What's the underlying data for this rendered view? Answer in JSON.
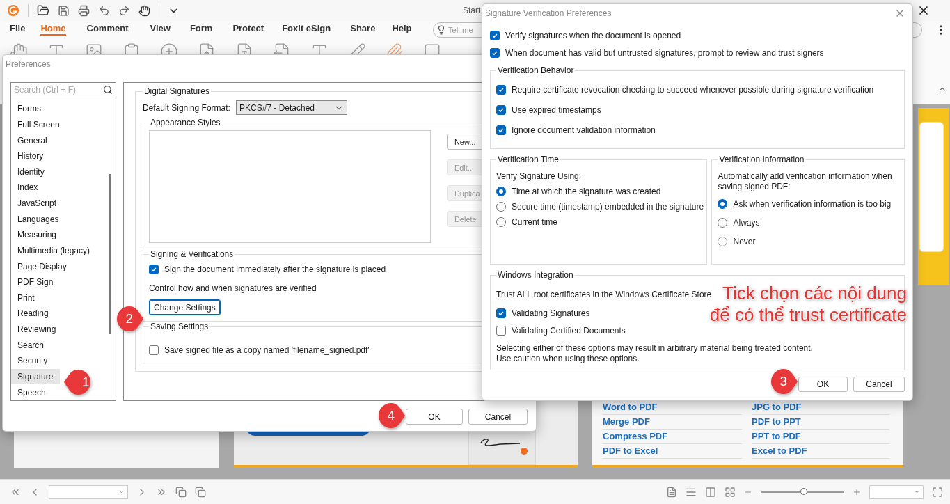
{
  "app": {
    "title": "Start",
    "menu": [
      {
        "label": "File",
        "selected": false
      },
      {
        "label": "Home",
        "selected": true
      },
      {
        "label": "Comment",
        "selected": false
      },
      {
        "label": "View",
        "selected": false
      },
      {
        "label": "Form",
        "selected": false
      },
      {
        "label": "Protect",
        "selected": false
      },
      {
        "label": "Foxit eSign",
        "selected": false
      },
      {
        "label": "Share",
        "selected": false
      },
      {
        "label": "Help",
        "selected": false
      }
    ],
    "search_placeholder": "Tell me",
    "quick_links": [
      {
        "label": "Word to PDF"
      },
      {
        "label": "JPG to PDF"
      },
      {
        "label": "Merge PDF"
      },
      {
        "label": "PDF to PPT"
      },
      {
        "label": "Compress PDF"
      },
      {
        "label": "PPT to PDF"
      },
      {
        "label": "PDF to Excel"
      },
      {
        "label": "Excel to PDF"
      }
    ],
    "zoom_slider": {
      "level": 0.52
    }
  },
  "preferences": {
    "title": "Preferences",
    "search_placeholder": "Search (Ctrl + F)",
    "categories": [
      {
        "label": "Forms",
        "selected": false
      },
      {
        "label": "Full Screen",
        "selected": false
      },
      {
        "label": "General",
        "selected": false
      },
      {
        "label": "History",
        "selected": false
      },
      {
        "label": "Identity",
        "selected": false
      },
      {
        "label": "Index",
        "selected": false
      },
      {
        "label": "JavaScript",
        "selected": false
      },
      {
        "label": "Languages",
        "selected": false
      },
      {
        "label": "Measuring",
        "selected": false
      },
      {
        "label": "Multimedia (legacy)",
        "selected": false
      },
      {
        "label": "Page Display",
        "selected": false
      },
      {
        "label": "PDF Sign",
        "selected": false
      },
      {
        "label": "Print",
        "selected": false
      },
      {
        "label": "Reading",
        "selected": false
      },
      {
        "label": "Reviewing",
        "selected": false
      },
      {
        "label": "Search",
        "selected": false
      },
      {
        "label": "Security",
        "selected": false
      },
      {
        "label": "Signature",
        "selected": true
      },
      {
        "label": "Speech",
        "selected": false
      }
    ],
    "digital_signatures": {
      "title": "Digital Signatures",
      "format_label": "Default Signing Format:",
      "format_value": "PKCS#7 - Detached"
    },
    "appearance_styles": {
      "title": "Appearance Styles",
      "buttons": [
        {
          "label": "New...",
          "disabled": false
        },
        {
          "label": "Edit...",
          "disabled": true
        },
        {
          "label": "Duplica",
          "disabled": true
        },
        {
          "label": "Delete",
          "disabled": true
        }
      ]
    },
    "signing": {
      "title": "Signing & Verifications",
      "option": {
        "label": "Sign the document immediately after the signature is placed",
        "checked": true
      },
      "description": "Control how and when signatures are verified",
      "button": "Change Settings"
    },
    "saving": {
      "title": "Saving Settings",
      "option": {
        "label": "Save signed file as a copy named 'filename_signed.pdf'",
        "checked": false
      }
    },
    "buttons": [
      "OK",
      "Cancel"
    ]
  },
  "verification": {
    "title": "Signature Verification Preferences",
    "options": [
      {
        "label": "Verify signatures when the document is opened",
        "checked": true
      },
      {
        "label": "When document has valid but untrusted signatures, prompt to review and trust signers",
        "checked": true
      }
    ],
    "behavior": {
      "title": "Verification Behavior",
      "options": [
        {
          "label": "Require certificate revocation checking to succeed whenever possible during signature verification",
          "checked": true
        },
        {
          "label": "Use expired timestamps",
          "checked": true
        },
        {
          "label": "Ignore document validation information",
          "checked": true
        }
      ]
    },
    "time": {
      "title": "Verification Time",
      "prompt": "Verify Signature Using:",
      "radios": [
        {
          "label": "Time at which the signature was created",
          "selected": true
        },
        {
          "label": "Secure time (timestamp) embedded in the signature",
          "selected": false
        },
        {
          "label": "Current time",
          "selected": false
        }
      ]
    },
    "info": {
      "title": "Verification Information",
      "prompt": "Automatically add verification information when saving signed PDF:",
      "radios": [
        {
          "label": "Ask when verification information is too big",
          "selected": true
        },
        {
          "label": "Always",
          "selected": false
        },
        {
          "label": "Never",
          "selected": false
        }
      ]
    },
    "windows": {
      "title": "Windows Integration",
      "prompt": "Trust ALL root certificates in the Windows Certificate Store",
      "options": [
        {
          "label": "Validating Signatures",
          "checked": true
        },
        {
          "label": "Validating Certified Documents",
          "checked": false
        }
      ],
      "note": [
        "Selecting either of these options may result in arbitrary material being treated content.",
        "Use caution when using these options."
      ]
    },
    "buttons": [
      "OK",
      "Cancel"
    ]
  },
  "callouts": [
    "1",
    "2",
    "3",
    "4"
  ],
  "annotation": [
    "Tick chọn các nội dung",
    "để có thể trust certificate"
  ]
}
